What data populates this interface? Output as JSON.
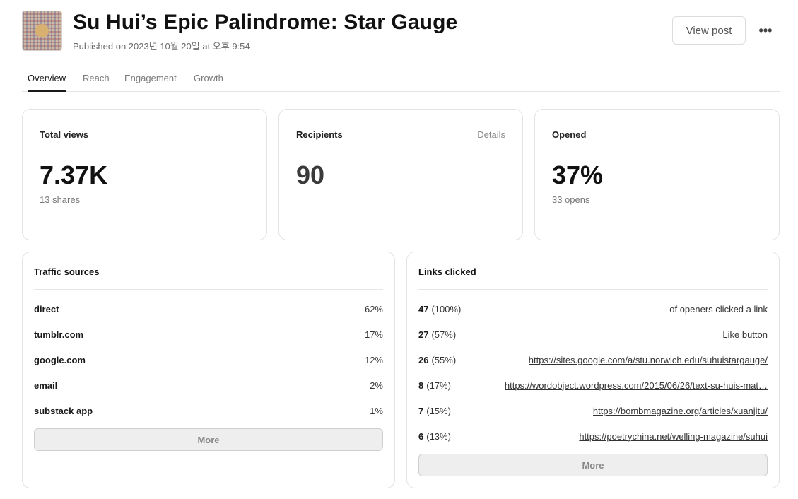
{
  "header": {
    "title": "Su Hui’s Epic Palindrome: Star Gauge",
    "published": "Published on 2023년 10월 20일 at 오후 9:54",
    "view_post_label": "View post",
    "more_icon": "ellipsis-icon",
    "more_label": "•••"
  },
  "tabs": [
    {
      "label": "Overview",
      "active": true
    },
    {
      "label": "Reach",
      "active": false
    },
    {
      "label": "Engagement",
      "active": false
    },
    {
      "label": "Growth",
      "active": false
    }
  ],
  "stats": {
    "total_views": {
      "label": "Total views",
      "value": "7.37K",
      "sub": "13 shares"
    },
    "recipients": {
      "label": "Recipients",
      "value": "90",
      "link": "Details"
    },
    "opened": {
      "label": "Opened",
      "value": "37%",
      "sub": "33 opens"
    }
  },
  "traffic_sources": {
    "title": "Traffic sources",
    "rows": [
      {
        "name": "direct",
        "value": "62%"
      },
      {
        "name": "tumblr.com",
        "value": "17%"
      },
      {
        "name": "google.com",
        "value": "12%"
      },
      {
        "name": "email",
        "value": "2%"
      },
      {
        "name": "substack app",
        "value": "1%"
      }
    ],
    "more_label": "More"
  },
  "links_clicked": {
    "title": "Links clicked",
    "rows": [
      {
        "count": "47",
        "pct": "(100%)",
        "target": "of openers clicked a link",
        "is_link": false
      },
      {
        "count": "27",
        "pct": "(57%)",
        "target": "Like button",
        "is_link": false
      },
      {
        "count": "26",
        "pct": "(55%)",
        "target": "https://sites.google.com/a/stu.norwich.edu/suhuistargauge/",
        "is_link": true
      },
      {
        "count": "8",
        "pct": "(17%)",
        "target": "https://wordobject.wordpress.com/2015/06/26/text-su-huis-mat…",
        "is_link": true
      },
      {
        "count": "7",
        "pct": "(15%)",
        "target": "https://bombmagazine.org/articles/xuanjitu/",
        "is_link": true
      },
      {
        "count": "6",
        "pct": "(13%)",
        "target": "https://poetrychina.net/welling-magazine/suhui",
        "is_link": true
      }
    ],
    "more_label": "More"
  }
}
